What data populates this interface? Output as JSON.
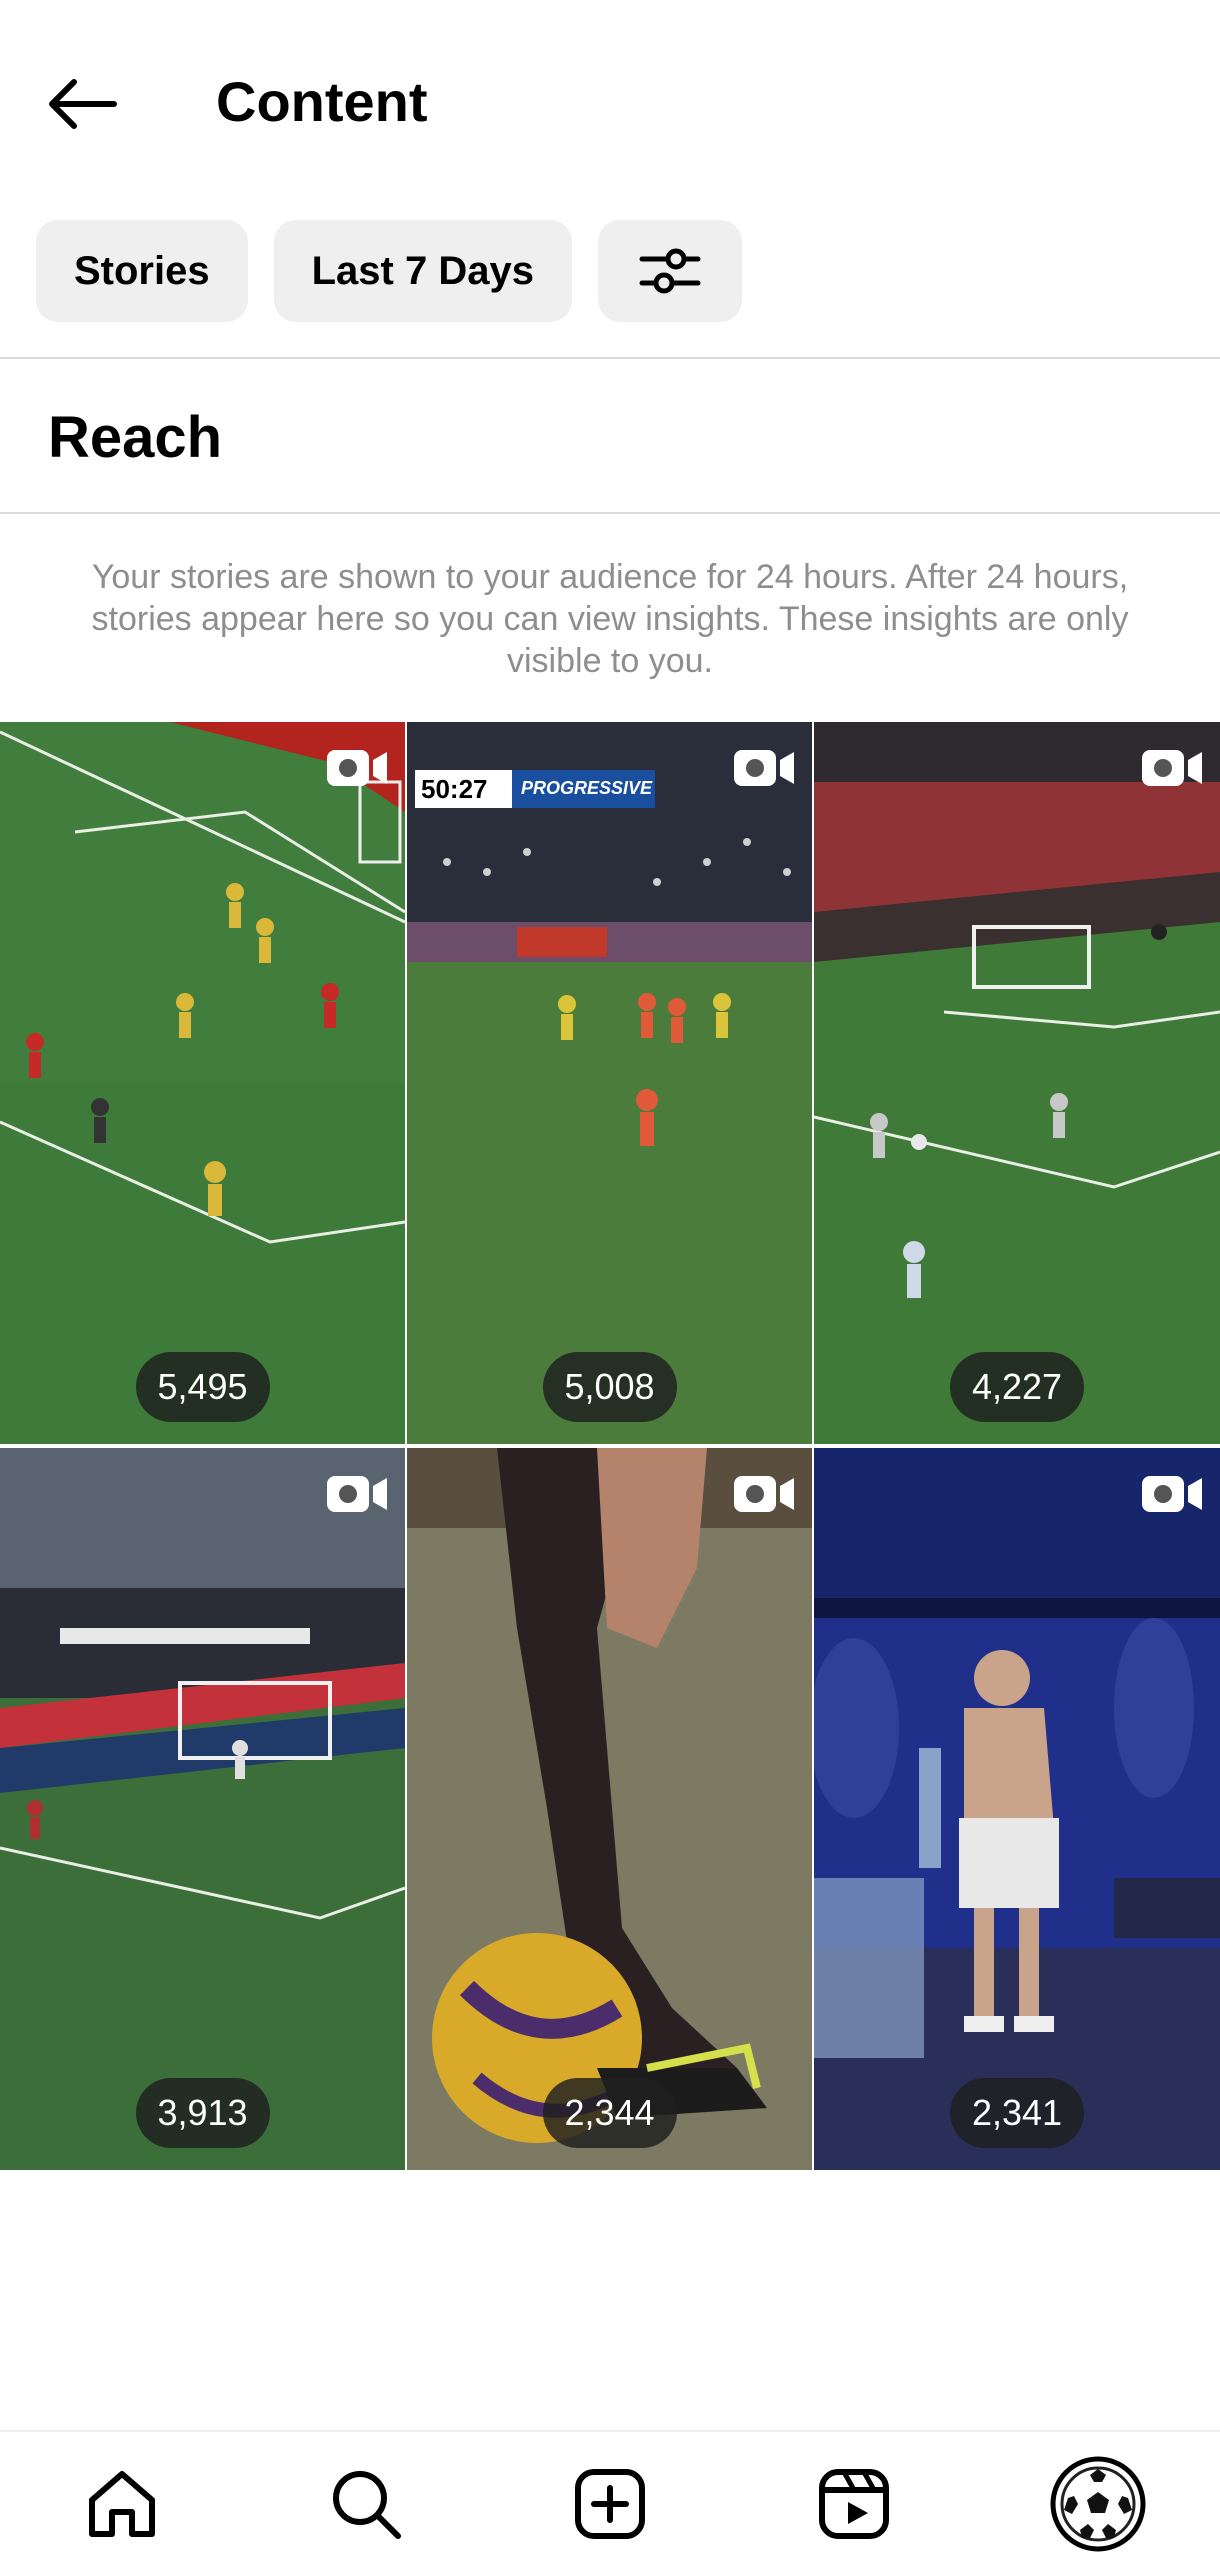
{
  "header": {
    "title": "Content",
    "back_icon": "arrow-left-icon"
  },
  "filters": {
    "type_label": "Stories",
    "range_label": "Last 7 Days",
    "settings_icon": "sliders-icon"
  },
  "section": {
    "title": "Reach"
  },
  "info": {
    "text": "Your stories are shown to your audience for 24 hours. After 24 hours, stories appear here so you can view insights. These insights are only visible to you."
  },
  "stories": [
    {
      "reach": "5,495",
      "scene": "football-pitch-red-yellow"
    },
    {
      "reach": "5,008",
      "scene": "football-stadium-scoreboard",
      "scoreboard_time": "50:27",
      "scoreboard_sponsor": "PROGRESSIVE"
    },
    {
      "reach": "4,227",
      "scene": "football-goal-area"
    },
    {
      "reach": "3,913",
      "scene": "football-stadium-night"
    },
    {
      "reach": "2,344",
      "scene": "football-ball-closeup"
    },
    {
      "reach": "2,341",
      "scene": "locker-room-player"
    }
  ],
  "nav": {
    "home_icon": "home-icon",
    "search_icon": "search-icon",
    "create_icon": "plus-square-icon",
    "reels_icon": "reels-icon",
    "profile_icon": "profile-avatar"
  },
  "colors": {
    "chip_bg": "#efefef",
    "muted_text": "#8e8e8e",
    "divider": "#dbdbdb"
  }
}
